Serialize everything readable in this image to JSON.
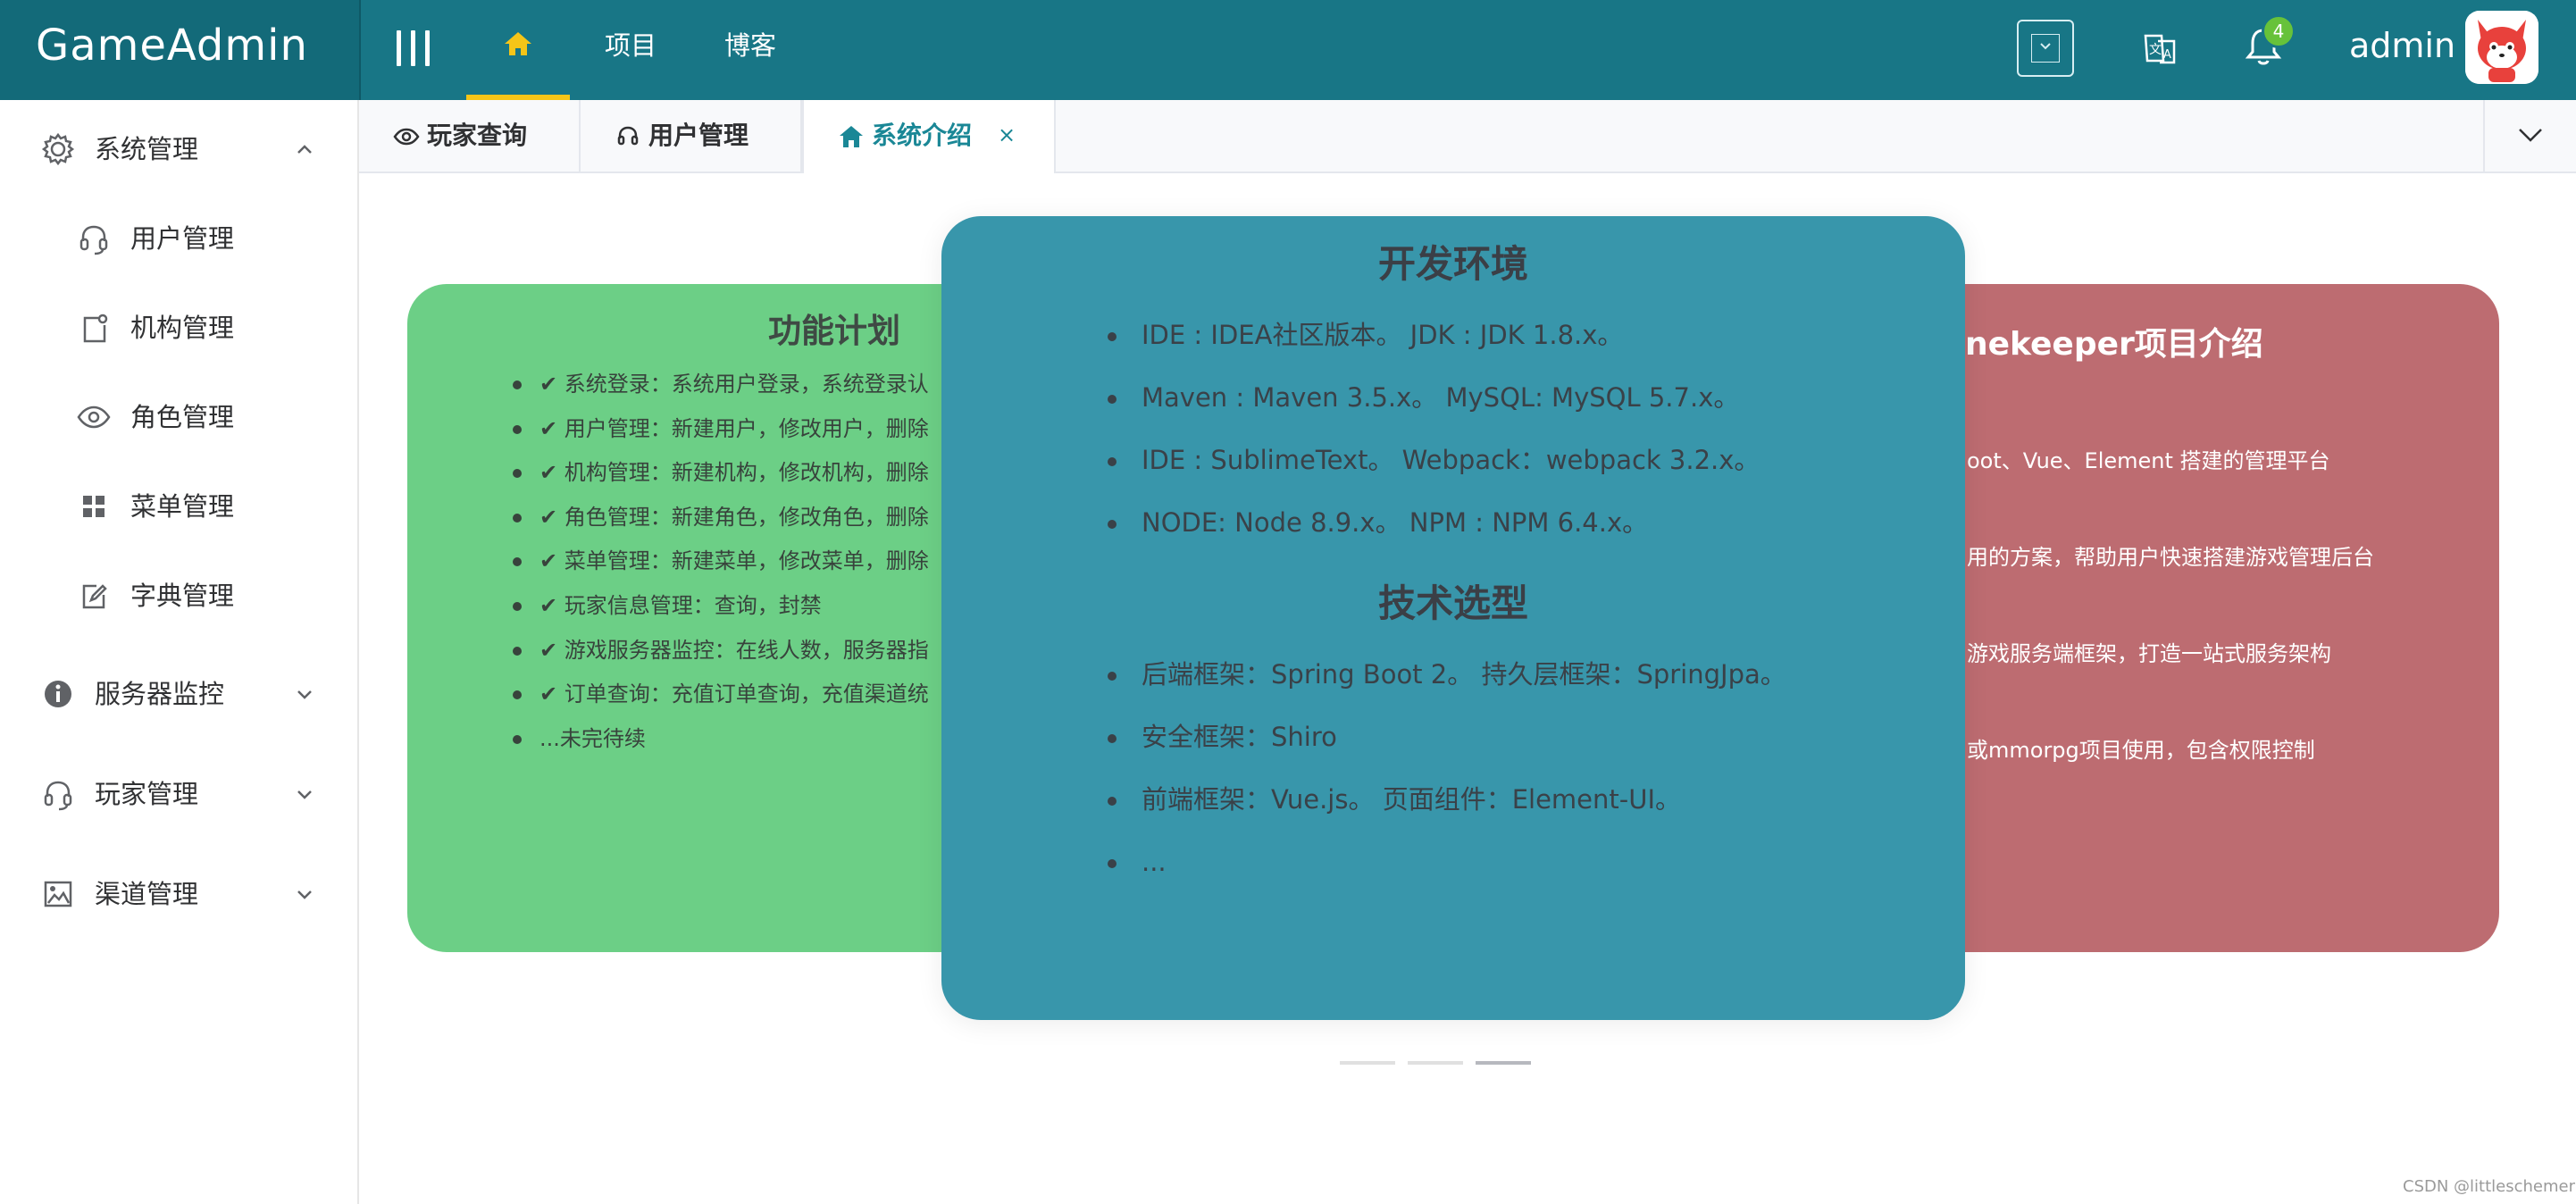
{
  "header": {
    "app_title": "GameAdmin",
    "nav": {
      "home_icon": "home-icon",
      "project": "项目",
      "blog": "博客"
    },
    "notification_count": "4",
    "username": "admin",
    "colors": {
      "bar": "#187686",
      "logo_bg": "#136a79",
      "active_underline": "#f5c518",
      "badge": "#67c23a"
    }
  },
  "sidebar": {
    "groups": [
      {
        "label": "系统管理",
        "icon": "gear-icon",
        "expanded": true,
        "items": [
          {
            "label": "用户管理",
            "icon": "headset-icon"
          },
          {
            "label": "机构管理",
            "icon": "org-icon"
          },
          {
            "label": "角色管理",
            "icon": "eye-icon"
          },
          {
            "label": "菜单管理",
            "icon": "grid-icon"
          },
          {
            "label": "字典管理",
            "icon": "edit-icon"
          }
        ]
      },
      {
        "label": "服务器监控",
        "icon": "info-icon",
        "expanded": false
      },
      {
        "label": "玩家管理",
        "icon": "headset-icon",
        "expanded": false
      },
      {
        "label": "渠道管理",
        "icon": "picture-icon",
        "expanded": false
      }
    ]
  },
  "tabs": [
    {
      "label": "玩家查询",
      "icon": "eye-icon",
      "active": false
    },
    {
      "label": "用户管理",
      "icon": "headset-icon",
      "active": false
    },
    {
      "label": "系统介绍",
      "icon": "home-icon",
      "active": true,
      "close": "×"
    }
  ],
  "carousel": {
    "active_index": 2,
    "cards": {
      "features": {
        "title": "功能计划",
        "items": [
          "✔ 系统登录：系统用户登录，系统登录认",
          "✔ 用户管理：新建用户，修改用户，删除",
          "✔ 机构管理：新建机构，修改机构，删除",
          "✔ 角色管理：新建角色，修改角色，删除",
          "✔ 菜单管理：新建菜单，修改菜单，删除",
          "✔ 玩家信息管理：查询，封禁",
          "✔ 游戏服务器监控：在线人数，服务器指",
          "✔ 订单查询：充值订单查询，充值渠道统",
          "...未完待续"
        ],
        "color": "#6ccf86"
      },
      "environment": {
        "title": "开发环境",
        "items": [
          "IDE : IDEA社区版本。 JDK : JDK 1.8.x。",
          "Maven : Maven 3.5.x。 MySQL: MySQL 5.7.x。",
          "IDE : SublimeText。 Webpack：webpack 3.2.x。",
          "NODE: Node 8.9.x。 NPM : NPM 6.4.x。"
        ],
        "tech_title": "技术选型",
        "tech_items": [
          "后端框架：Spring Boot 2。 持久层框架：SpringJpa。",
          "安全框架：Shiro",
          "前端框架：Vue.js。 页面组件：Element-UI。",
          "..."
        ],
        "color": "#3896ab"
      },
      "intro": {
        "title": "nekeeper项目介绍",
        "lines": [
          "oot、Vue、Element 搭建的管理平台",
          "用的方案，帮助用户快速搭建游戏管理后台",
          "游戏服务端框架，打造一站式服务架构",
          "或mmorpg项目使用，包含权限控制"
        ],
        "color": "#bd6c71"
      }
    }
  },
  "watermark": "CSDN @littleschemer"
}
